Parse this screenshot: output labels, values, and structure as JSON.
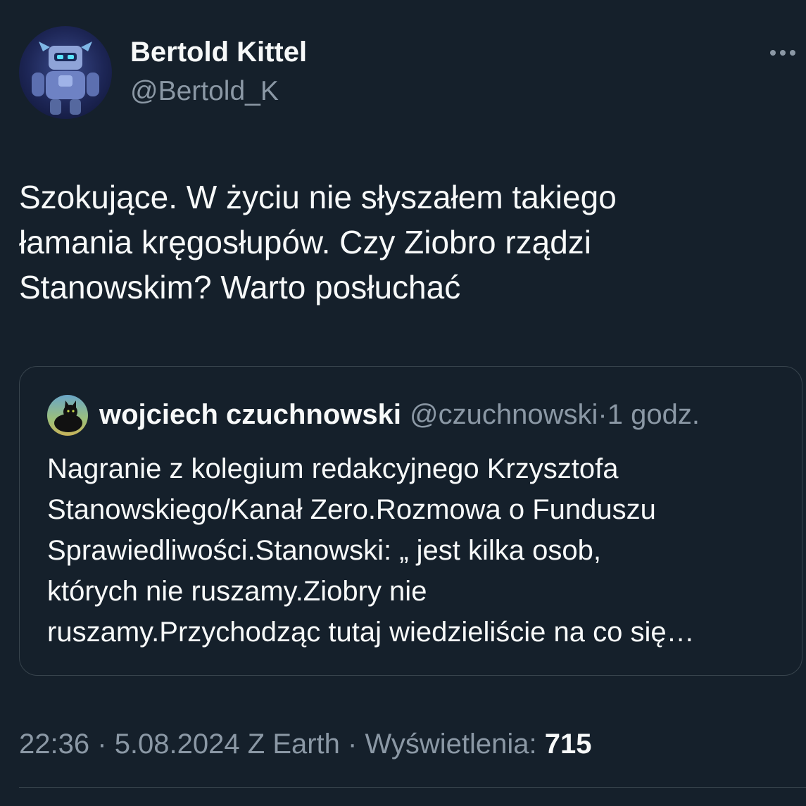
{
  "author": {
    "display_name": "Bertold Kittel",
    "handle": "@Bertold_K",
    "avatar_icon": "robot-knight-avatar"
  },
  "more_icon": "more-horizontal-icon",
  "tweet": {
    "text_lines": [
      "Szokujące. W życiu nie słyszałem takiego",
      "łamania kręgosłupów. Czy Ziobro rządzi",
      "Stanowskim? Warto posłuchać"
    ]
  },
  "quoted_tweet": {
    "display_name": "wojciech czuchnowski",
    "handle": "@czuchnowski",
    "time_separator": "·",
    "relative_time": "1 godz.",
    "avatar_icon": "black-cat-avatar",
    "text_lines": [
      "Nagranie z kolegium redakcyjnego Krzysztofa",
      "Stanowskiego/Kanał Zero.Rozmowa o Funduszu",
      "Sprawiedliwości.Stanowski: „ jest kilka osob,",
      "których nie ruszamy.Ziobry nie",
      "ruszamy.Przychodząc tutaj wiedzieliście na co się…"
    ]
  },
  "meta": {
    "time": "22:36",
    "date": "5.08.2024",
    "source": "Z Earth",
    "separator": "·",
    "views_label": "Wyświetlenia:",
    "views_count": "715"
  },
  "colors": {
    "background": "#15202b",
    "primary_text": "#f7f9f9",
    "secondary_text": "#8b98a5",
    "border": "#38444d"
  }
}
